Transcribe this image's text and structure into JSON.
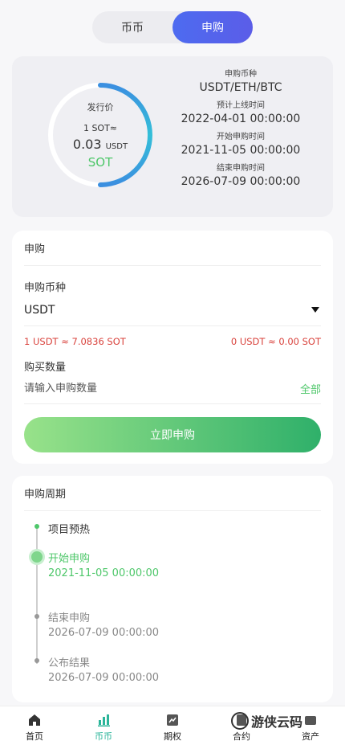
{
  "segment": {
    "tabs": [
      "币币",
      "申购"
    ],
    "active": 1
  },
  "issue": {
    "ring_label": "发行价",
    "ring_line1": "1 SOT≈",
    "price": "0.03",
    "price_unit": "USDT",
    "coin": "SOT",
    "progress_fraction": 0.5
  },
  "info": [
    {
      "label": "申购币种",
      "value": "USDT/ETH/BTC"
    },
    {
      "label": "预计上线时间",
      "value": "2022-04-01 00:00:00"
    },
    {
      "label": "开始申购时间",
      "value": "2021-11-05 00:00:00"
    },
    {
      "label": "结束申购时间",
      "value": "2026-07-09 00:00:00"
    }
  ],
  "subscribe": {
    "title": "申购",
    "currency_label": "申购币种",
    "currency_value": "USDT",
    "rate_left": "1 USDT ≈ 7.0836 SOT",
    "rate_right": "0 USDT ≈ 0.00 SOT",
    "qty_label": "购买数量",
    "qty_placeholder": "请输入申购数量",
    "all_label": "全部",
    "button_label": "立即申购"
  },
  "period": {
    "title": "申购周期",
    "steps": [
      {
        "name": "项目预热",
        "time": ""
      },
      {
        "name": "开始申购",
        "time": "2021-11-05 00:00:00"
      },
      {
        "name": "结束申购",
        "time": "2026-07-09 00:00:00"
      },
      {
        "name": "公布结果",
        "time": "2026-07-09 00:00:00"
      }
    ]
  },
  "tabbar": {
    "items": [
      {
        "label": "首页",
        "icon": "home-icon"
      },
      {
        "label": "币币",
        "icon": "bar-chart-icon"
      },
      {
        "label": "期权",
        "icon": "options-icon"
      },
      {
        "label": "合约",
        "icon": "contract-icon"
      },
      {
        "label": "资产",
        "icon": "assets-icon"
      }
    ],
    "active": 1
  },
  "watermark": "游侠云码",
  "colors": {
    "accent_blue": "#4d6bf0",
    "green": "#4ec76a",
    "red": "#d9433d",
    "ring": "#3aa7d9"
  }
}
